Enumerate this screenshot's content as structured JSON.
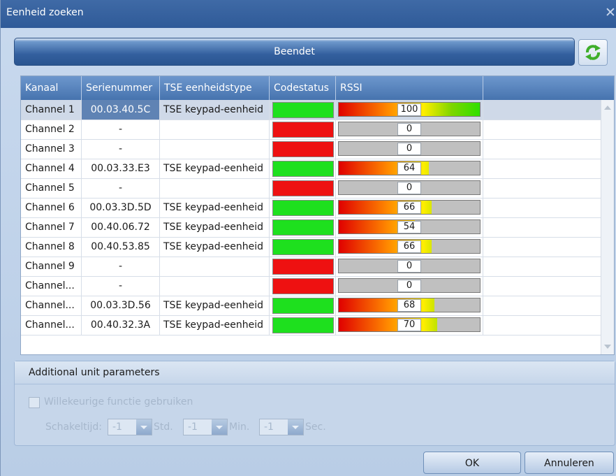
{
  "window": {
    "title": "Eenheid zoeken"
  },
  "status": {
    "label": "Beendet"
  },
  "grid": {
    "columns": [
      "Kanaal",
      "Serienummer",
      "TSE eenheidstype",
      "Codestatus",
      "RSSI"
    ],
    "rows": [
      {
        "kanaal": "Channel 1",
        "serial": "00.03.40.5C",
        "type": "TSE keypad-eenheid",
        "code": "ok",
        "rssi": "100",
        "rssi_level": 100,
        "selected": true
      },
      {
        "kanaal": "Channel 2",
        "serial": "-",
        "type": "",
        "code": "fail",
        "rssi": "0",
        "rssi_level": 0
      },
      {
        "kanaal": "Channel 3",
        "serial": "-",
        "type": "",
        "code": "fail",
        "rssi": "0",
        "rssi_level": 0
      },
      {
        "kanaal": "Channel 4",
        "serial": "00.03.33.E3",
        "type": "TSE keypad-eenheid",
        "code": "ok",
        "rssi": "64",
        "rssi_level": 64
      },
      {
        "kanaal": "Channel 5",
        "serial": "-",
        "type": "",
        "code": "fail",
        "rssi": "0",
        "rssi_level": 0
      },
      {
        "kanaal": "Channel 6",
        "serial": "00.03.3D.5D",
        "type": "TSE keypad-eenheid",
        "code": "ok",
        "rssi": "66",
        "rssi_level": 66
      },
      {
        "kanaal": "Channel 7",
        "serial": "00.40.06.72",
        "type": "TSE keypad-eenheid",
        "code": "ok",
        "rssi": "54",
        "rssi_level": 54
      },
      {
        "kanaal": "Channel 8",
        "serial": "00.40.53.85",
        "type": "TSE keypad-eenheid",
        "code": "ok",
        "rssi": "66",
        "rssi_level": 66
      },
      {
        "kanaal": "Channel 9",
        "serial": "-",
        "type": "",
        "code": "fail",
        "rssi": "0",
        "rssi_level": 0
      },
      {
        "kanaal": "Channel...",
        "serial": "-",
        "type": "",
        "code": "fail",
        "rssi": "0",
        "rssi_level": 0
      },
      {
        "kanaal": "Channel...",
        "serial": "00.03.3D.56",
        "type": "TSE keypad-eenheid",
        "code": "ok",
        "rssi": "68",
        "rssi_level": 68
      },
      {
        "kanaal": "Channel...",
        "serial": "00.40.32.3A",
        "type": "TSE keypad-eenheid",
        "code": "ok",
        "rssi": "70",
        "rssi_level": 70
      }
    ]
  },
  "params": {
    "header": "Additional unit parameters",
    "checkbox_label": "Willekeurige functie gebruiken",
    "checked": false,
    "schakeltijd_label": "Schakeltijd:",
    "hours": {
      "value": "-1",
      "unit": "Std."
    },
    "minutes": {
      "value": "-1",
      "unit": "Min."
    },
    "seconds": {
      "value": "-1",
      "unit": "Sec."
    }
  },
  "buttons": {
    "ok": "OK",
    "cancel": "Annuleren"
  },
  "colors": {
    "code_ok": "#1ee01e",
    "code_fail": "#ee1111",
    "title_bar": "#3f6aa6"
  }
}
